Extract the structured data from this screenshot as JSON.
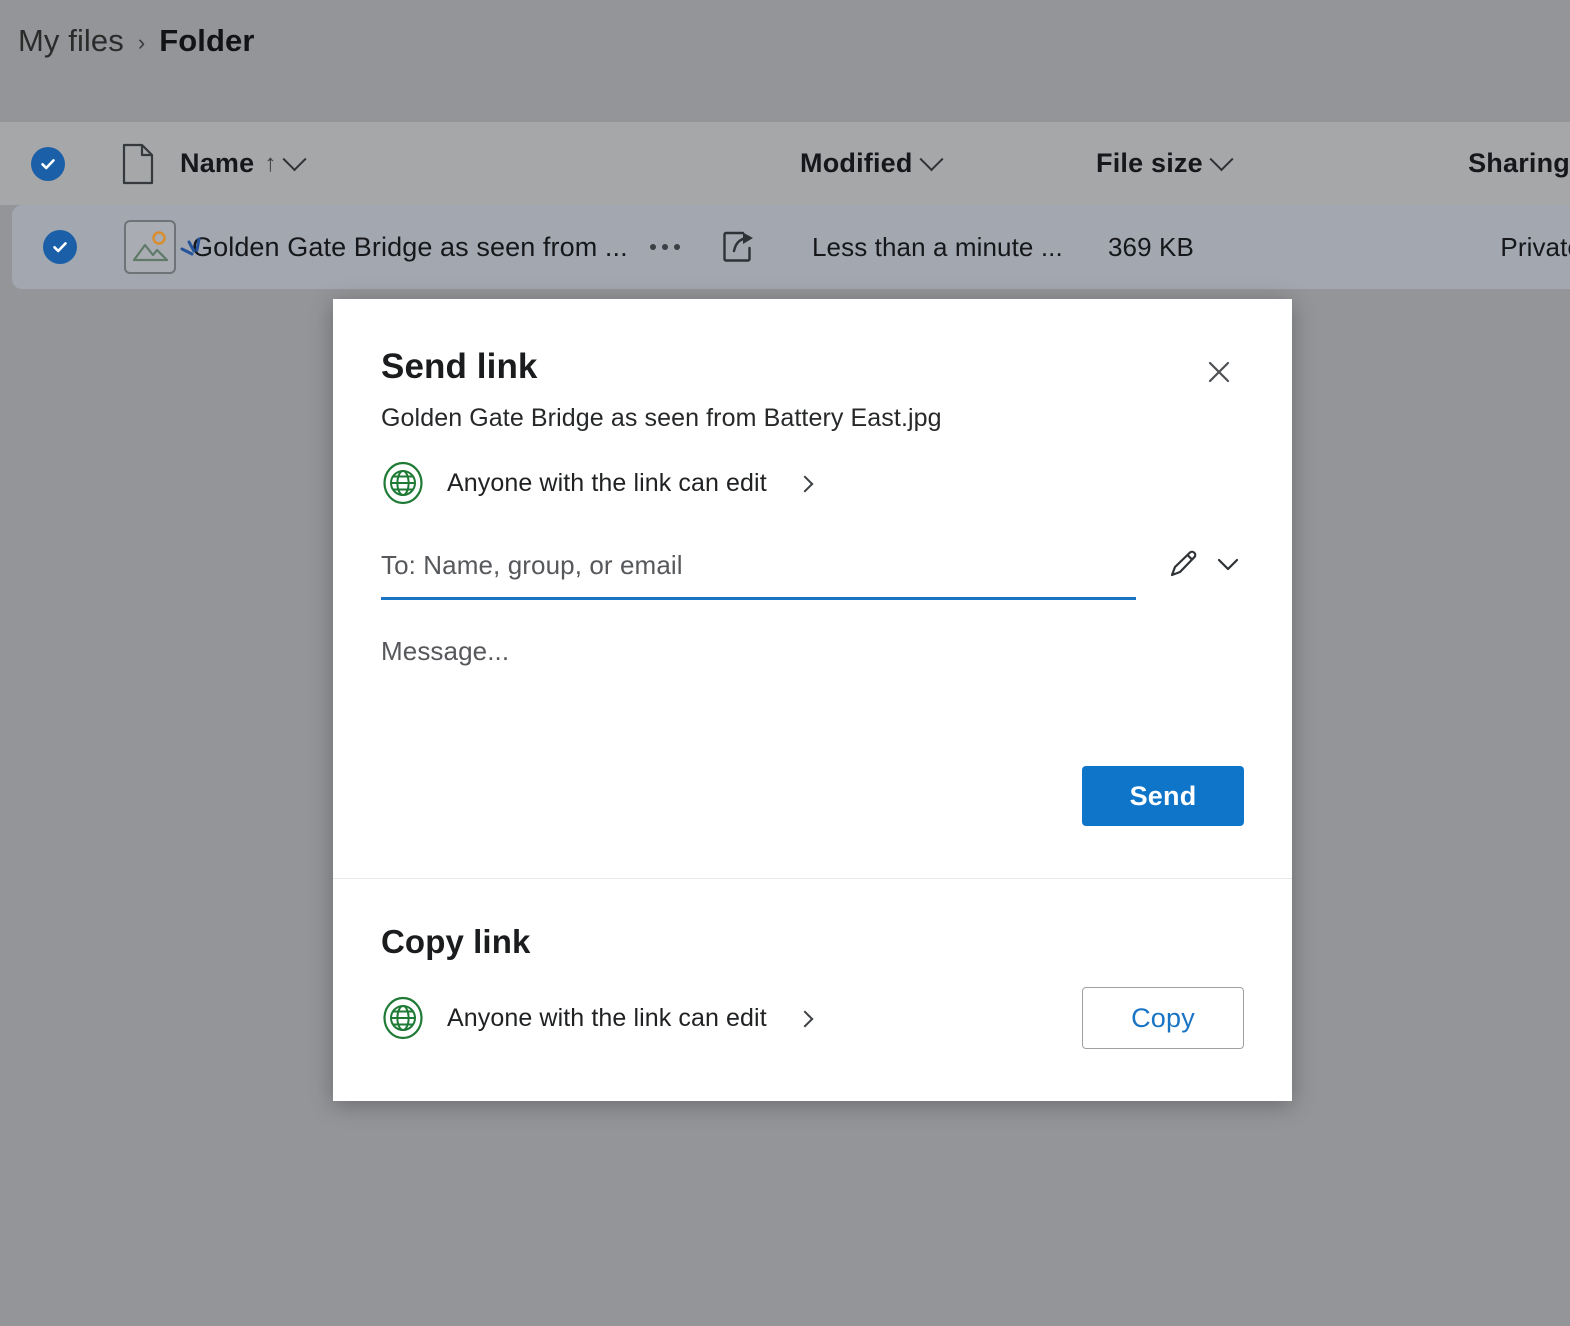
{
  "breadcrumb": {
    "root": "My files",
    "separator": "›",
    "current": "Folder"
  },
  "filelist": {
    "columns": {
      "name": "Name",
      "sort_arrow": "↑",
      "modified": "Modified",
      "file_size": "File size",
      "sharing": "Sharing"
    },
    "rows": [
      {
        "name": "Golden Gate Bridge as seen from ...",
        "modified": "Less than a minute ...",
        "size": "369 KB",
        "sharing": "Private"
      }
    ]
  },
  "dialog": {
    "title": "Send link",
    "subtitle": "Golden Gate Bridge as seen from Battery East.jpg",
    "permission": "Anyone with the link can edit",
    "to_placeholder": "To: Name, group, or email",
    "to_value": "",
    "message_placeholder": "Message...",
    "message_value": "",
    "send_label": "Send",
    "copy_section_title": "Copy link",
    "copy_permission": "Anyone with the link can edit",
    "copy_label": "Copy"
  },
  "colors": {
    "background": "#939598",
    "header_band": "#a6a7a9",
    "row_selected": "#a3a7b0",
    "accent_blue": "#0f75c9",
    "check_blue": "#1b5fa8",
    "link_blue": "#1974c4",
    "globe_green": "#1e7a34",
    "dialog_bg": "#ffffff"
  }
}
